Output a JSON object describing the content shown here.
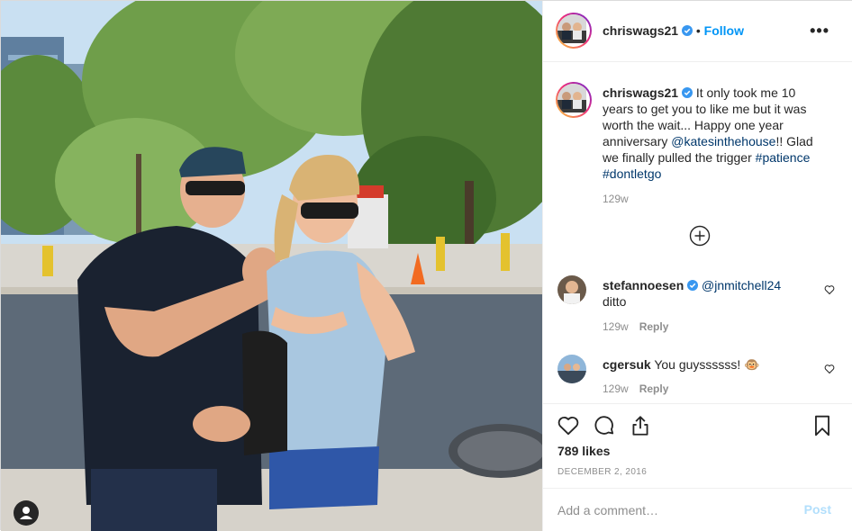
{
  "post": {
    "author": "chriswags21",
    "verified": true,
    "follow_label": "Follow",
    "more_label": "•••",
    "caption": {
      "username": "chriswags21",
      "text_1": " It only took me 10 years to get you to like me but it was worth the wait... Happy one year anniversary ",
      "mention": "@katesinthehouse",
      "text_2": "!! Glad we finally pulled the trigger ",
      "hashtag_1": "#patience",
      "hashtag_2": "#dontletgo",
      "age": "129w"
    },
    "comments": [
      {
        "username": "stefannoesen",
        "verified": true,
        "mention": "@jnmitchell24",
        "text": "ditto",
        "age": "129w",
        "reply_label": "Reply"
      },
      {
        "username": "cgersuk",
        "verified": false,
        "text": " You guyssssss! 🐵",
        "age": "129w",
        "reply_label": "Reply"
      }
    ],
    "likes": "789 likes",
    "date": "DECEMBER 2, 2016",
    "comment_placeholder": "Add a comment…",
    "post_label": "Post"
  },
  "icons": {
    "verified": "verified-badge-icon",
    "more": "more-options-icon",
    "load_more": "load-more-comments-icon",
    "like": "heart-icon",
    "comment": "comment-icon",
    "share": "share-icon",
    "save": "bookmark-icon",
    "tag": "user-tag-icon"
  },
  "colors": {
    "accent": "#0095f6",
    "link": "#00376b",
    "muted": "#8e8e8e",
    "post_disabled": "#b2dffc"
  }
}
